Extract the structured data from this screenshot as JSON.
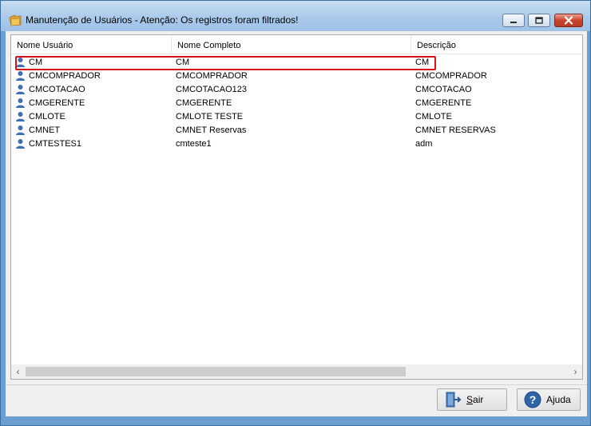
{
  "window": {
    "title": "Manutenção de Usuários - Atenção: Os registros foram filtrados!"
  },
  "columns": [
    "Nome Usuário",
    "Nome Completo",
    "Descrição"
  ],
  "rows": [
    {
      "name": "CM",
      "full": "CM",
      "desc": "CM"
    },
    {
      "name": "CMCOMPRADOR",
      "full": "CMCOMPRADOR",
      "desc": "CMCOMPRADOR"
    },
    {
      "name": "CMCOTACAO",
      "full": "CMCOTACAO123",
      "desc": "CMCOTACAO"
    },
    {
      "name": "CMGERENTE",
      "full": "CMGERENTE",
      "desc": "CMGERENTE"
    },
    {
      "name": "CMLOTE",
      "full": "CMLOTE TESTE",
      "desc": "CMLOTE"
    },
    {
      "name": "CMNET",
      "full": "CMNET Reservas",
      "desc": "CMNET RESERVAS"
    },
    {
      "name": "CMTESTES1",
      "full": "cmteste1",
      "desc": "adm"
    }
  ],
  "buttons": {
    "sair": "Sair",
    "ajuda": "Ajuda"
  },
  "icons": {
    "title": "folder-icon",
    "row": "user-icon",
    "sair": "exit-door-icon",
    "ajuda": "help-icon"
  },
  "colors": {
    "titlebar": "#a9c9ea",
    "highlight": "#d4141a",
    "user_icon": "#3d6fb4"
  }
}
